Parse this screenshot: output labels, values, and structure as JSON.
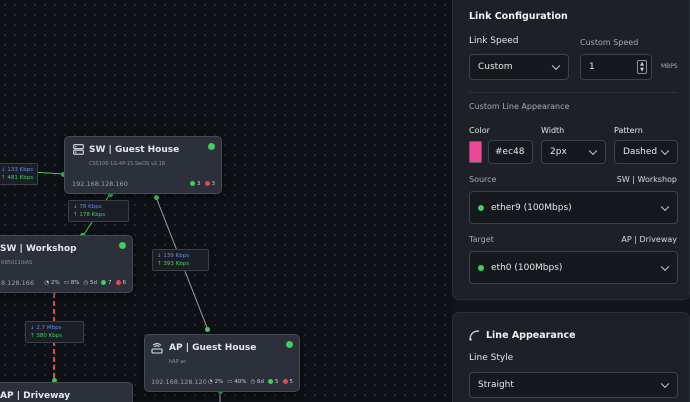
{
  "canvas": {
    "nodes": {
      "sw_guest": {
        "title": "SW | Guest House",
        "model": "CSS106-1G-4P-1S SwOS v2.18",
        "ip": "192.168.128.160",
        "green_count": "3",
        "red_count": "3"
      },
      "sw_workshop": {
        "title": "SW | Workshop",
        "model": "RB5011UiAS",
        "ip": "8.128.166",
        "cpu": "2%",
        "mem": "8%",
        "uptime": "5d",
        "green_count": "7",
        "red_count": "6"
      },
      "ap_guest": {
        "title": "AP | Guest House",
        "model": "hAP ac",
        "ip": "192.168.128.120",
        "cpu": "2%",
        "mem": "40%",
        "uptime": "6d",
        "green_count": "5",
        "red_count": "5"
      },
      "ap_driveway": {
        "title": "AP | Driveway"
      }
    },
    "rates": {
      "left": {
        "down": "↓ 133 Kbps",
        "up": "↑ 481 Kbps"
      },
      "guest_workshop": {
        "down": "↓ 78 Kbps",
        "up": "↑ 178 Kbps"
      },
      "guest_ap": {
        "down": "↓ 139 Kbps",
        "up": "↑ 393 Kbps"
      },
      "workshop_driveway": {
        "down": "↓ 2.7 Mbps",
        "up": "↑ 380 Kbps"
      }
    }
  },
  "panel": {
    "link_config": {
      "heading": "Link Configuration",
      "link_speed_label": "Link Speed",
      "link_speed_value": "Custom",
      "custom_speed_label": "Custom Speed",
      "custom_speed_value": "1",
      "custom_speed_unit": "MBPS",
      "custom_line_label": "Custom Line Appearance",
      "color_label": "Color",
      "color_value": "#ec48",
      "color_swatch": "#ec4899",
      "width_label": "Width",
      "width_value": "2px",
      "pattern_label": "Pattern",
      "pattern_value": "Dashed",
      "source_label": "Source",
      "source_device": "SW | Workshop",
      "source_value": "ether9 (100Mbps)",
      "target_label": "Target",
      "target_device": "AP | Driveway",
      "target_value": "eth0 (100Mbps)"
    },
    "line_appearance": {
      "heading": "Line Appearance",
      "line_style_label": "Line Style",
      "line_style_value": "Straight"
    }
  },
  "colors": {
    "accent_green": "#3ecf5e",
    "alert_red": "#e5484d",
    "rate_blue": "#5b8df0",
    "link_red": "#e5484d"
  }
}
